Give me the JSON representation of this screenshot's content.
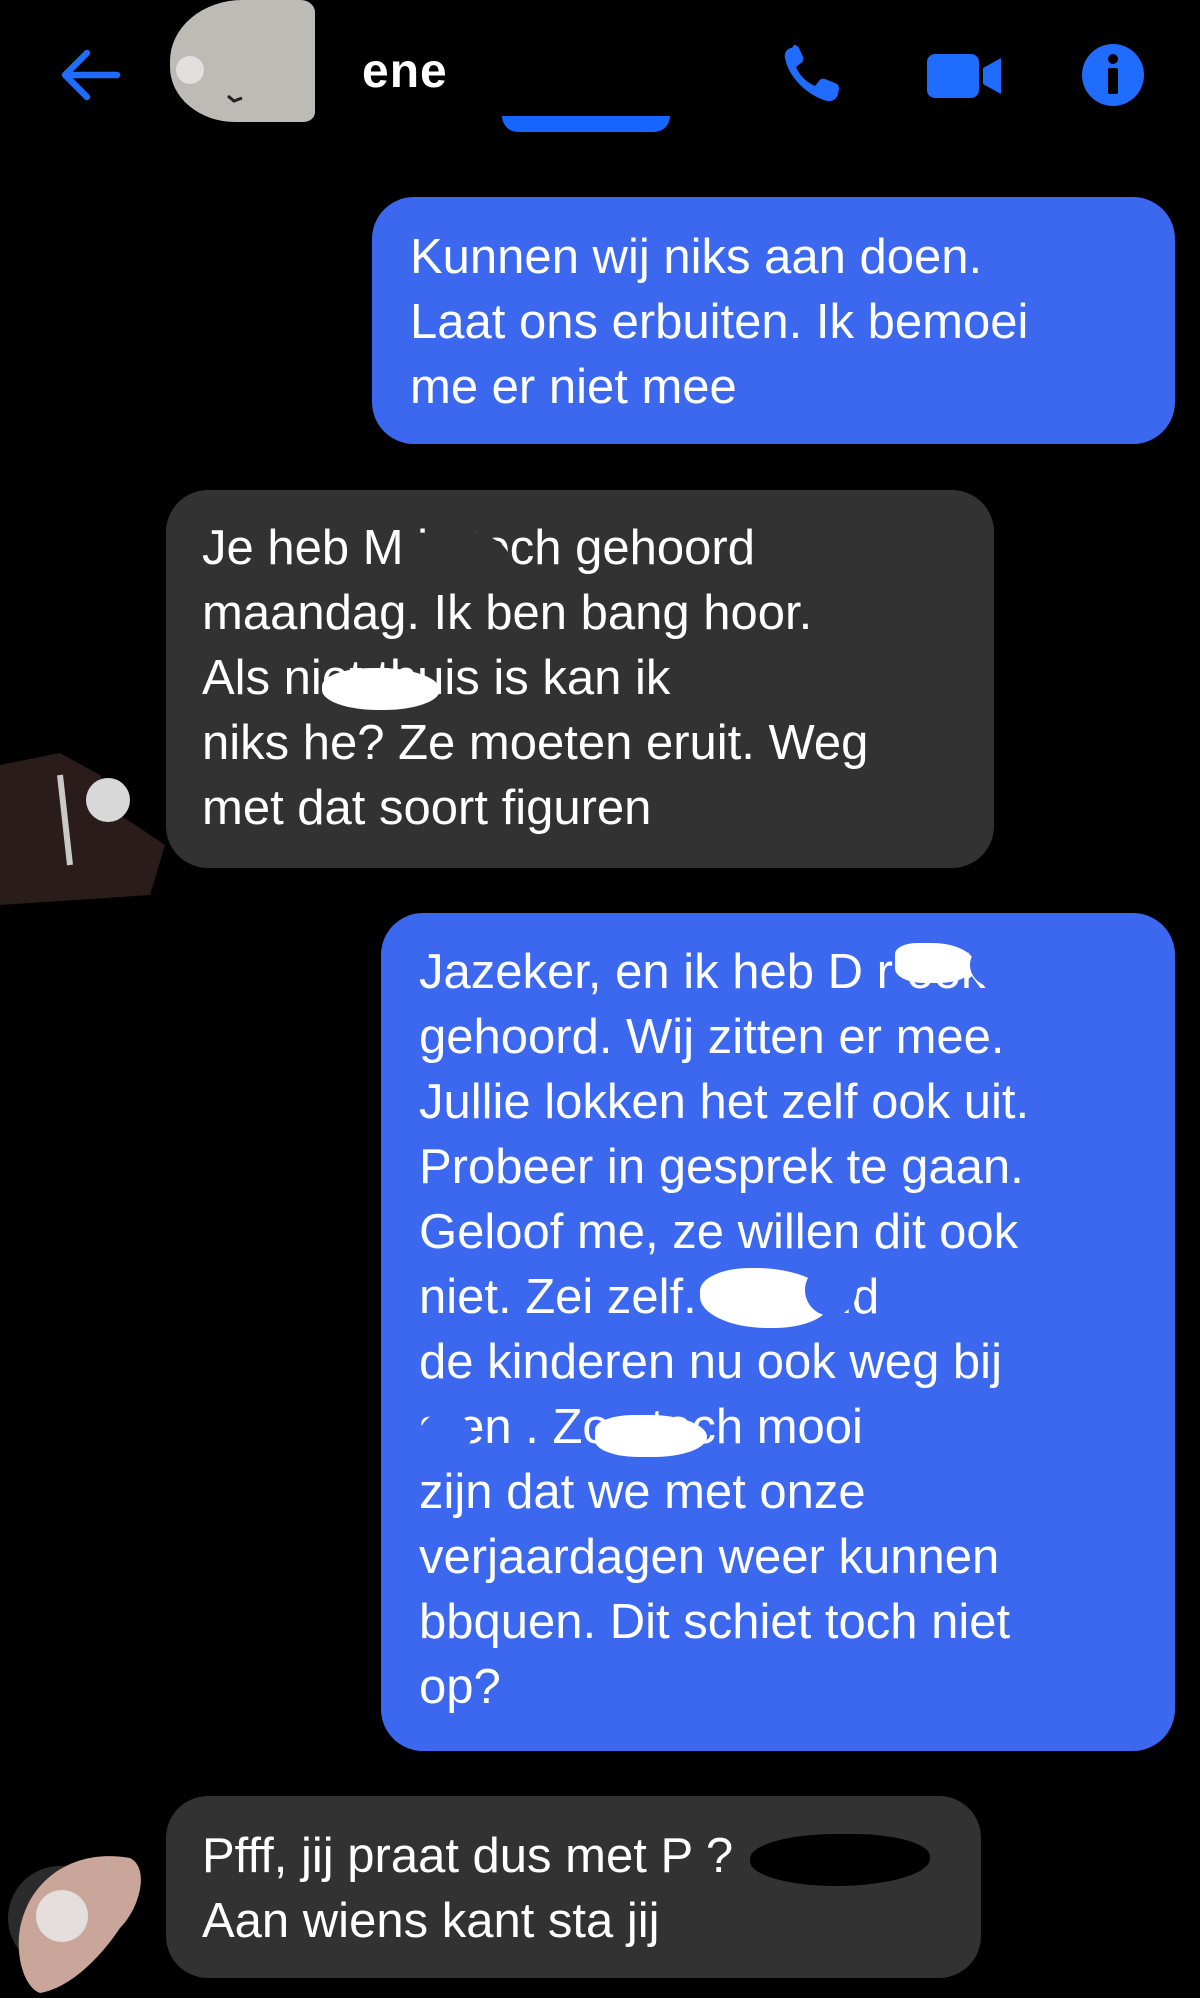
{
  "header": {
    "contact_name": "ene",
    "icons": {
      "back": "arrow-left-icon",
      "call": "phone-icon",
      "video": "video-camera-icon",
      "info": "info-icon"
    },
    "accent_color": "#1565ff"
  },
  "messages": [
    {
      "direction": "outgoing",
      "text": "Kunnen wij niks aan doen.\nLaat ons erbuiten.  Ik bemoei\nme er niet mee"
    },
    {
      "direction": "incoming",
      "text": "Je heb M     in toch gehoord\nmaandag.  Ik ben bang hoor.\nAls              niet thuis is kan ik\nniks he? Ze moeten eruit. Weg\nmet dat soort figuren"
    },
    {
      "direction": "outgoing",
      "text": "Jazeker,  en ik heb D      r ook\ngehoord. Wij zitten er mee.\nJullie lokken het zelf ook uit.\nProbeer in gesprek te gaan.\nGeloof me, ze willen dit ook\nniet. Zei               zelf. Jij houd\nde kinderen nu ook weg bij\n     s en        . Zou toch mooi\nzijn dat we met onze\nverjaardagen weer kunnen\nbbquen.  Dit schiet toch niet\nop?"
    },
    {
      "direction": "incoming",
      "text": "Pfff, jij praat dus met P          ?\nAan wiens kant sta jij"
    }
  ],
  "colors": {
    "background": "#000000",
    "outgoing_bubble": "#3c68ef",
    "incoming_bubble": "#323232",
    "text": "#ffffff"
  }
}
